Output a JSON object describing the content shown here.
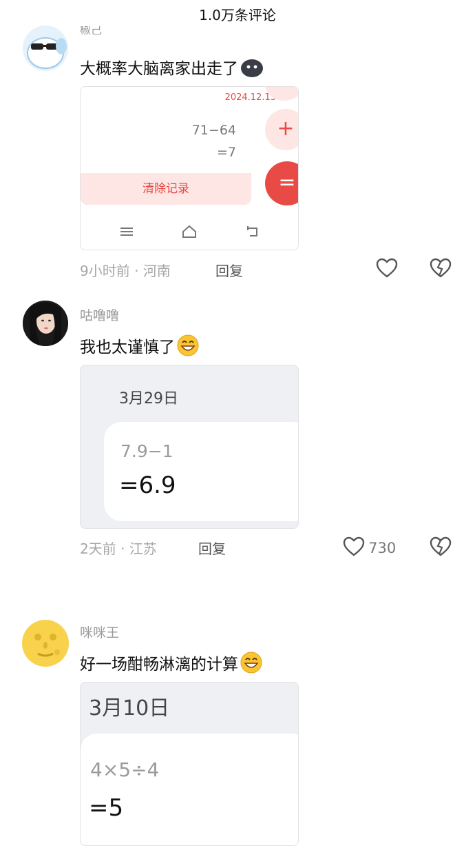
{
  "header": {
    "title": "1.0万条评论"
  },
  "comments": [
    {
      "username": "椒己",
      "text": "大概率大脑离家出走了",
      "shot": {
        "date": "2024.12.13",
        "expr": "71−64",
        "result": "=7",
        "clear": "清除记录",
        "plus": "+",
        "equals": "="
      },
      "time": "9小时前",
      "location": "河南",
      "reply": "回复",
      "likes": ""
    },
    {
      "username": "咕噜噜",
      "text": "我也太谨慎了",
      "shot": {
        "date": "3月29日",
        "expr": "7.9−1",
        "result": "=6.9"
      },
      "time": "2天前",
      "location": "江苏",
      "reply": "回复",
      "likes": "730"
    },
    {
      "username": "咪咪王",
      "text": "好一场酣畅淋漓的计算",
      "shot": {
        "date": "3月10日",
        "expr": "4×5÷4",
        "result": "=5"
      }
    }
  ],
  "separator": "·",
  "colors": {
    "accent": "#e84a45",
    "meta": "#a6a6a6",
    "card_bg": "#eef0f4"
  }
}
